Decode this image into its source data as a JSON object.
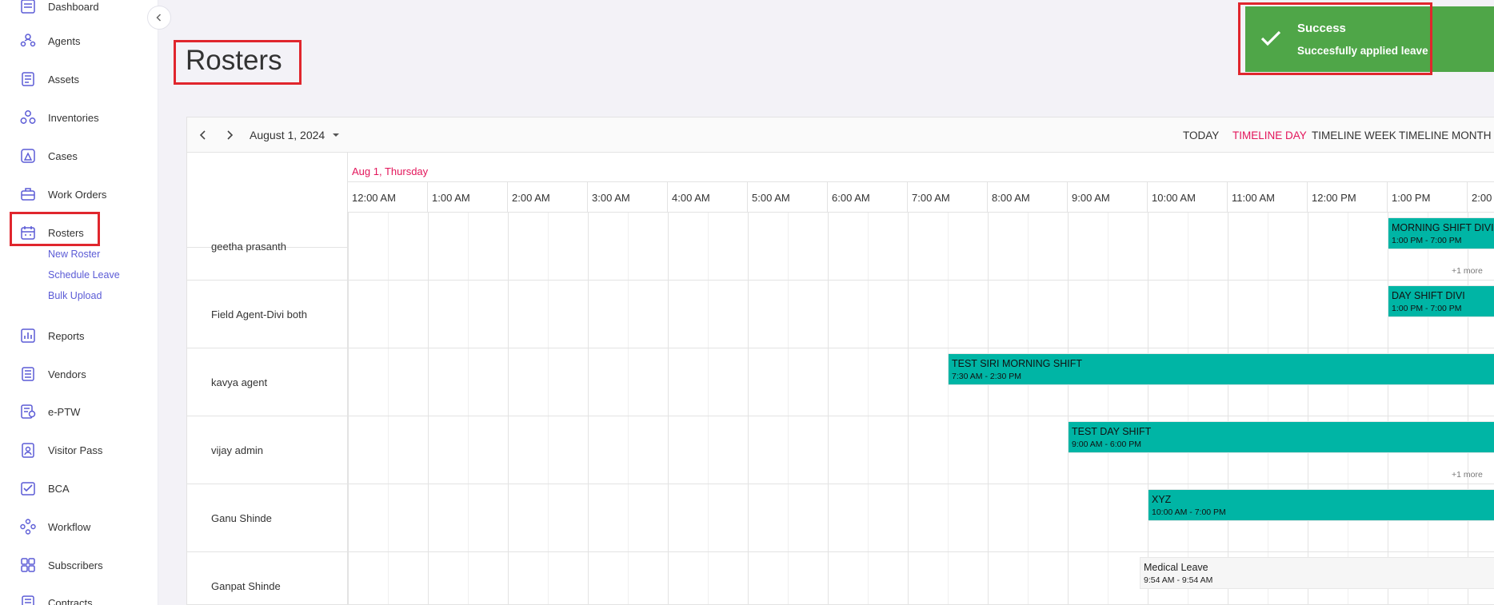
{
  "sidebar": {
    "items": [
      {
        "key": "dashboard",
        "label": "Dashboard",
        "icon": "dashboard-icon"
      },
      {
        "key": "agents",
        "label": "Agents",
        "icon": "agents-icon"
      },
      {
        "key": "assets",
        "label": "Assets",
        "icon": "assets-icon"
      },
      {
        "key": "inventories",
        "label": "Inventories",
        "icon": "inventories-icon"
      },
      {
        "key": "cases",
        "label": "Cases",
        "icon": "cases-icon"
      },
      {
        "key": "work_orders",
        "label": "Work Orders",
        "icon": "work-orders-icon"
      },
      {
        "key": "rosters",
        "label": "Rosters",
        "icon": "rosters-icon"
      },
      {
        "key": "reports",
        "label": "Reports",
        "icon": "reports-icon"
      },
      {
        "key": "vendors",
        "label": "Vendors",
        "icon": "vendors-icon"
      },
      {
        "key": "eptw",
        "label": "e-PTW",
        "icon": "eptw-icon"
      },
      {
        "key": "visitor_pass",
        "label": "Visitor Pass",
        "icon": "visitor-pass-icon"
      },
      {
        "key": "bca",
        "label": "BCA",
        "icon": "bca-icon"
      },
      {
        "key": "workflow",
        "label": "Workflow",
        "icon": "workflow-icon"
      },
      {
        "key": "subscribers",
        "label": "Subscribers",
        "icon": "subscribers-icon"
      },
      {
        "key": "contracts",
        "label": "Contracts",
        "icon": "contracts-icon"
      }
    ],
    "rosters_sub": [
      "New Roster",
      "Schedule Leave",
      "Bulk Upload"
    ],
    "accent": "#5b5bd6"
  },
  "page": {
    "title": "Rosters"
  },
  "toast": {
    "title": "Success",
    "message": "Succesfully applied leave",
    "color": "#4fa648"
  },
  "scheduler": {
    "date_label": "August 1, 2024",
    "views": [
      "TODAY",
      "TIMELINE DAY",
      "TIMELINE WEEK",
      "TIMELINE MONTH"
    ],
    "active_view": "TIMELINE DAY",
    "day_header": "Aug 1, Thursday",
    "time_slots": [
      "12:00 AM",
      "1:00 AM",
      "2:00 AM",
      "3:00 AM",
      "4:00 AM",
      "5:00 AM",
      "6:00 AM",
      "7:00 AM",
      "8:00 AM",
      "9:00 AM",
      "10:00 AM",
      "11:00 AM",
      "12:00 PM",
      "1:00 PM",
      "2:00"
    ],
    "resources": [
      "geetha prasanth",
      "Field Agent-Divi both",
      "kavya agent",
      "vijay admin",
      "Ganu Shinde",
      "Ganpat Shinde"
    ],
    "events": [
      {
        "row": 0,
        "start": 13.0,
        "title": "MORNING SHIFT DIVI",
        "time": "1:00 PM - 7:00 PM",
        "kind": "shift"
      },
      {
        "row": 1,
        "start": 13.0,
        "title": "DAY SHIFT DIVI",
        "time": "1:00 PM - 7:00 PM",
        "kind": "shift"
      },
      {
        "row": 2,
        "start": 7.5,
        "title": "TEST SIRI MORNING SHIFT",
        "time": "7:30 AM - 2:30 PM",
        "kind": "shift"
      },
      {
        "row": 3,
        "start": 9.0,
        "title": "TEST DAY SHIFT",
        "time": "9:00 AM - 6:00 PM",
        "kind": "shift"
      },
      {
        "row": 4,
        "start": 10.0,
        "title": "XYZ",
        "time": "10:00 AM - 7:00 PM",
        "kind": "shift"
      },
      {
        "row": 5,
        "start": 9.9,
        "title": "Medical Leave",
        "time": "9:54 AM - 9:54 AM",
        "kind": "leave"
      }
    ],
    "more_indicators": [
      {
        "row": 0,
        "label": "+1 more"
      },
      {
        "row": 3,
        "label": "+1 more"
      }
    ],
    "event_color": "#00b5a5",
    "active_color": "#e3165b"
  }
}
